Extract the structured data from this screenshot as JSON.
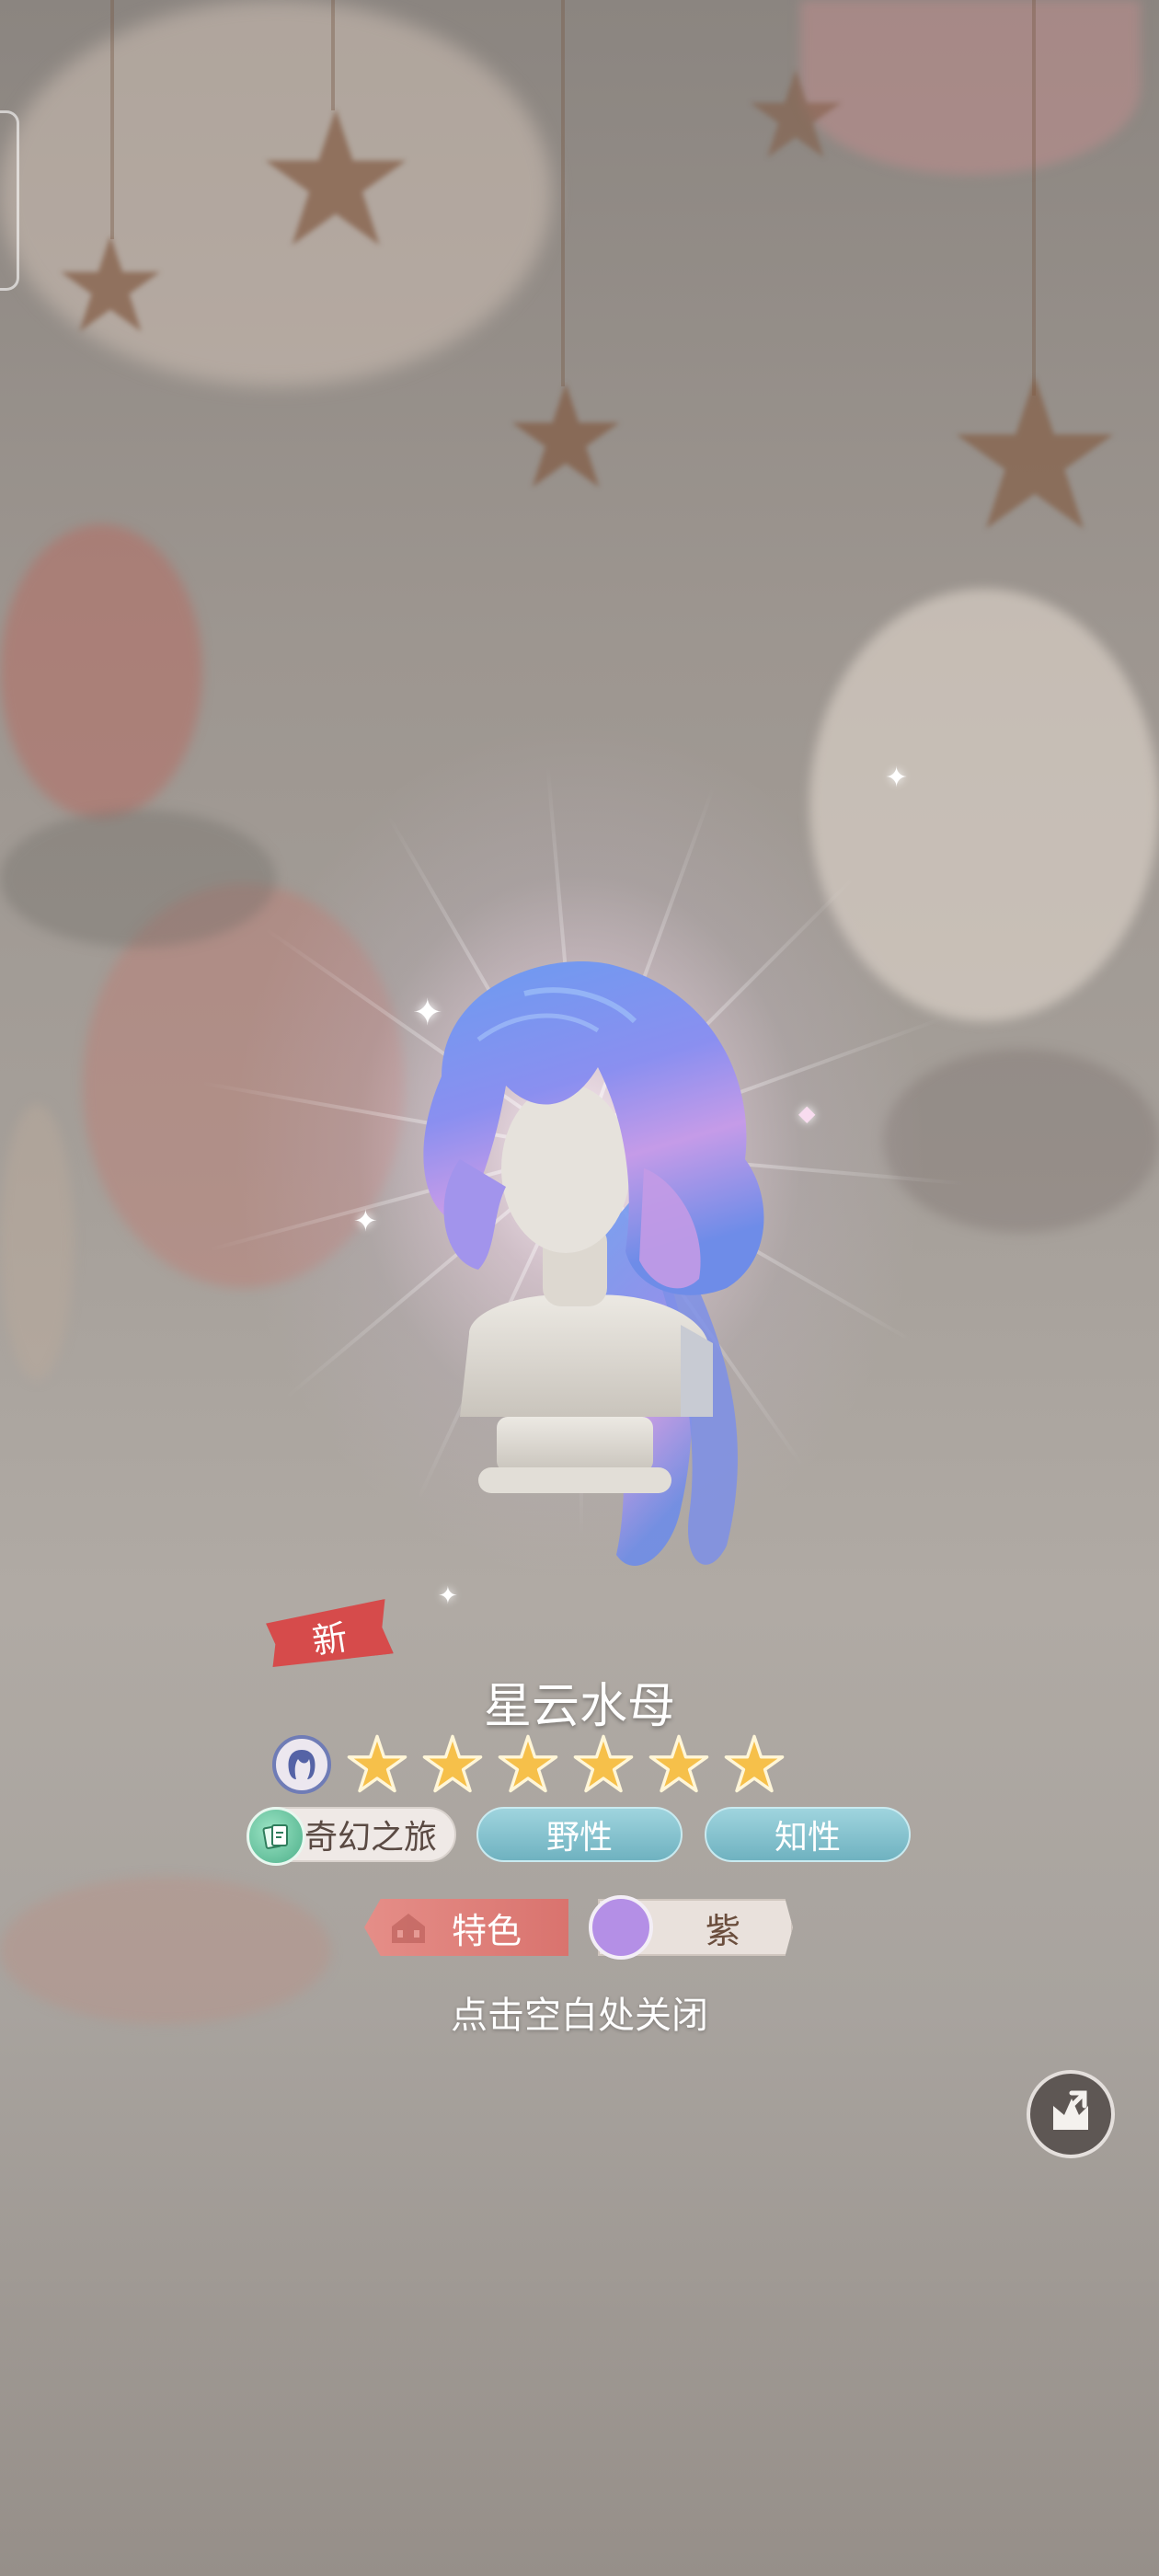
{
  "item": {
    "new_label": "新",
    "name": "星云水母",
    "rarity_stars": 6,
    "type_icon": "hair-icon"
  },
  "tags": {
    "source": {
      "label": "奇幻之旅",
      "icon": "cards-icon"
    },
    "styles": [
      "野性",
      "知性"
    ],
    "feature": "特色",
    "color": {
      "label": "紫",
      "swatch": "#b48fe6"
    }
  },
  "close_hint": "点击空白处关闭",
  "share_icon": "share-icon",
  "colors": {
    "star": "#f6c04a",
    "new_tag": "#d64b4b",
    "style_tag": "#7fbfcc",
    "feature_tag": "#dd7c76"
  }
}
